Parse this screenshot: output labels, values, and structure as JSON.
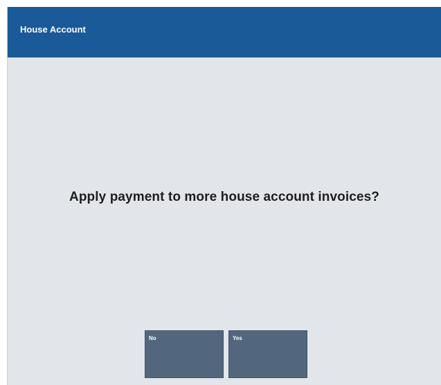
{
  "window": {
    "title": "House Account"
  },
  "prompt": {
    "message": "Apply payment to more house account invoices?"
  },
  "buttons": {
    "no_label": "No",
    "yes_label": "Yes"
  },
  "colors": {
    "title_bar": "#1a5a99",
    "background": "#e2e5ea",
    "button": "#52677e"
  }
}
